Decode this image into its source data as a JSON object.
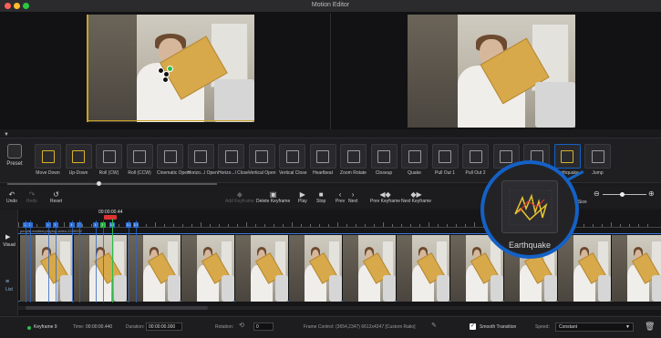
{
  "window": {
    "title": "Motion Editor"
  },
  "preset_panel": {
    "preset_label": "Preset",
    "tiles": [
      "Move Down",
      "Up-Down",
      "Roll (CW)",
      "Roll (CCW)",
      "Cinematic Open",
      "Horizo...l Open",
      "Horizo...l Close",
      "Vertical Open",
      "Vertical Close",
      "Heartbeat",
      "Zoom Rotate",
      "Closeup",
      "Quake",
      "Pull Out 1",
      "Pull Out 2",
      "",
      "Scan",
      "Earthquake",
      "Jump"
    ],
    "highlighted_tile": "Earthquake"
  },
  "toolbar": {
    "undo": "Undo",
    "redo": "Redo",
    "reset": "Reset",
    "add_keyframe": "Add Keyframe",
    "delete_keyframe": "Delete Keyframe",
    "play": "Play",
    "stop": "Stop",
    "prev": "Prev",
    "next": "Next",
    "prev_keyframe": "Prev Keyframe",
    "next_keyframe": "Next Keyframe",
    "fit_size": "Fit Size"
  },
  "side": {
    "visual": "Visual",
    "list": "List"
  },
  "timeline": {
    "current_time": "00:00:00.44",
    "clip_name": "people-excited-playing-video-1290032",
    "keyframes": [
      "2",
      "3",
      "4",
      "5",
      "6",
      "7",
      "8",
      "9",
      "10",
      "11",
      "12"
    ],
    "active_keyframe": "9"
  },
  "statusbar": {
    "keyframe_label": "Keyframe 9",
    "time_label": "Time:",
    "time_value": "00:00:00.440",
    "duration_label": "Duration:",
    "duration_value": "00:00:00.000",
    "rotation_label": "Rotation:",
    "rotation_value": "0",
    "frame_control_label": "Frame Control:",
    "frame_control_value": "(3654,2347)  6612x4247  [Custom Ratio]",
    "smooth_transition_label": "Smooth Transition",
    "smooth_transition_checked": true,
    "speed_label": "Speed:",
    "speed_value": "Constant"
  },
  "callout": {
    "label": "Earthquake"
  },
  "colors": {
    "accent_blue": "#1461c6",
    "keyframe_blue": "#2e6fd8",
    "active_green": "#2bbb4a",
    "gold": "#d8b32f"
  }
}
